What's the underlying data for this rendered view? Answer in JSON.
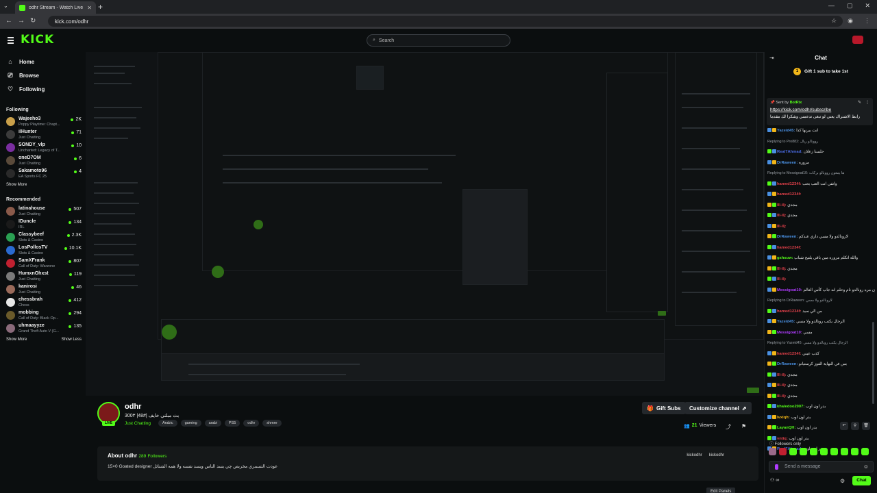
{
  "browser": {
    "tab_title": "odhr Stream - Watch Live on Ki",
    "url": "kick.com/odhr"
  },
  "topbar": {
    "logo": "KICK",
    "search_placeholder": "Search"
  },
  "sidebar": {
    "nav": [
      {
        "label": "Home",
        "icon": "home-icon"
      },
      {
        "label": "Browse",
        "icon": "browse-icon"
      },
      {
        "label": "Following",
        "icon": "heart-icon"
      }
    ],
    "following_title": "Following",
    "following": [
      {
        "name": "Wajeeho3",
        "sub": "Poppy Playtime: Chapt...",
        "count": "2K",
        "color": "#c9a04a"
      },
      {
        "name": "iIHunter",
        "sub": "Just Chatting",
        "count": "71",
        "color": "#3b3b3b"
      },
      {
        "name": "SONDY_vlp",
        "sub": "Uncharted: Legacy of T...",
        "count": "10",
        "color": "#7a2ea0"
      },
      {
        "name": "oneD7OM",
        "sub": "Just Chatting",
        "count": "6",
        "color": "#5a4a3a"
      },
      {
        "name": "Sakamoto96",
        "sub": "EA Sports FC 25",
        "count": "4",
        "color": "#2a2a2a"
      }
    ],
    "show_more_1": "Show More",
    "recommended_title": "Recommended",
    "recommended": [
      {
        "name": "latinahouse",
        "sub": "Just Chatting",
        "count": "507",
        "color": "#8a5a4a"
      },
      {
        "name": "IDuncle",
        "sub": "IRL",
        "count": "134",
        "color": "#1a1a1a"
      },
      {
        "name": "Classybeef",
        "sub": "Slots & Casino",
        "count": "2.3K",
        "color": "#2aa052"
      },
      {
        "name": "LosPollosTV",
        "sub": "Slots & Casino",
        "count": "10.1K",
        "color": "#2a6ad0"
      },
      {
        "name": "SamXFrank",
        "sub": "Call of Duty: Warzone",
        "count": "807",
        "color": "#c02030"
      },
      {
        "name": "HumxnOhxst",
        "sub": "Just Chatting",
        "count": "119",
        "color": "#7a7a7a"
      },
      {
        "name": "kanirosi",
        "sub": "Just Chatting",
        "count": "46",
        "color": "#9a6a5a"
      },
      {
        "name": "chessbrah",
        "sub": "Chess",
        "count": "412",
        "color": "#e8e8e8"
      },
      {
        "name": "mobbing",
        "sub": "Call of Duty: Black Op...",
        "count": "294",
        "color": "#6a5a2a"
      },
      {
        "name": "uhmaayyze",
        "sub": "Grand Theft Auto V (G...",
        "count": "135",
        "color": "#8a6a7a"
      }
    ],
    "show_more_2": "Show More",
    "show_less": "Show Less"
  },
  "channel": {
    "name": "odhr",
    "stream_title": "بث مبلني خايف |#48| 300٣",
    "category": "Just Chatting",
    "tags": [
      "Arabic",
      "gaming",
      "arabi",
      "PS5",
      "odhr",
      "shmre"
    ],
    "gift_subs": "Gift Subs",
    "customize": "Customize channel",
    "viewers_count": "21",
    "viewers_label": "Viewers",
    "live_badge": "LIVE",
    "about_title": "About odhr",
    "followers_count": "289",
    "followers_label": "Followers",
    "about_desc": "15×0 Goated designer عودت التسمري مخربص چي يسد الناس ويسد نفسه ولا همه الشتائل",
    "social_1": "kickodhr",
    "social_2": "kickodhr",
    "edit_label": "Edit Panels"
  },
  "chat": {
    "title": "Chat",
    "gift_banner": "Gift 1 sub to take 1st",
    "pinned_sent_by": "Sent by",
    "pinned_user": "BotRix",
    "pinned_link": "https://kick.com/odhr/subscribe",
    "pinned_text": "رابط الاشتراك يعني لو تبغى تدعمني وشكرا لك مقدما",
    "messages": [
      {
        "user": "Yazeid45:",
        "text": "انت بيرنها كذا",
        "color": "#4a90e2",
        "reply": ""
      },
      {
        "user": "",
        "text": "",
        "color": "#9aa0a6",
        "reply": "Replying to Pro882: روونالو ريال"
      },
      {
        "user": "Real7Ahmad:",
        "text": "حلسنا زعلان",
        "color": "#4a6ae2",
        "reply": ""
      },
      {
        "user": "DrRaween:",
        "text": "مزوره",
        "color": "#4a90e2",
        "reply": ""
      },
      {
        "user": "",
        "text": "",
        "color": "#9aa0a6",
        "reply": "Replying to Messigoat10: ها يمعون روونالو بركات"
      },
      {
        "user": "hamed1234f:",
        "text": "وانفي انت العب بحب",
        "color": "#e2404a",
        "reply": ""
      },
      {
        "user": "hamed1234f:",
        "text": "",
        "color": "#e2404a",
        "reply": ""
      },
      {
        "user": "lll-ilj:",
        "text": "مجدي",
        "color": "#e2404a",
        "reply": ""
      },
      {
        "user": "lll-ilj:",
        "text": "مجدي",
        "color": "#e2404a",
        "reply": ""
      },
      {
        "user": "lll-ilj:",
        "text": "",
        "color": "#e2404a",
        "reply": ""
      },
      {
        "user": "DrRaween:",
        "text": "لارونالدو ولا مسي داري عندكم",
        "color": "#4a90e2",
        "reply": ""
      },
      {
        "user": "hamed1234f:",
        "text": "",
        "color": "#e2404a",
        "reply": ""
      },
      {
        "user": "gshsuw:",
        "text": "والله اتكلم مزوره مين باقي يلتيح شباب",
        "color": "#53fc18",
        "reply": ""
      },
      {
        "user": "lll-ilj:",
        "text": "مجدي",
        "color": "#e2404a",
        "reply": ""
      },
      {
        "user": "lll-ilj:",
        "text": "",
        "color": "#e2404a",
        "reply": ""
      },
      {
        "user": "Messigoat10:",
        "text": "يقولون مره رونالدو نام وحلم انه جاب كأس العالم",
        "color": "#b03cff",
        "reply": ""
      },
      {
        "user": "",
        "text": "",
        "color": "#9aa0a6",
        "reply": "Replying to DrRaween: لارونالدو ولا مسي"
      },
      {
        "user": "hamed1234f:",
        "text": "من الي سيد",
        "color": "#e2404a",
        "reply": ""
      },
      {
        "user": "Yazeid45:",
        "text": "الرجال يكتب رونالدو ولا مسي",
        "color": "#4a90e2",
        "reply": ""
      },
      {
        "user": "Messigoat10:",
        "text": "مسي",
        "color": "#b03cff",
        "reply": ""
      },
      {
        "user": "",
        "text": "",
        "color": "#9aa0a6",
        "reply": "Replying to Yazeid45: الرجال يكتب رونالدو ولا مسي"
      },
      {
        "user": "hamed1234f:",
        "text": "كذب عيني",
        "color": "#e2404a",
        "reply": ""
      },
      {
        "user": "DrRaween:",
        "text": "بس في النهاية الفوز كرستيانو",
        "color": "#4a90e2",
        "reply": ""
      },
      {
        "user": "lll-ilj:",
        "text": "مجدي",
        "color": "#e2404a",
        "reply": ""
      },
      {
        "user": "lll-ilj:",
        "text": "مجدي",
        "color": "#e2404a",
        "reply": ""
      },
      {
        "user": "lll-ilj:",
        "text": "مجدي",
        "color": "#e2404a",
        "reply": ""
      },
      {
        "user": "khaledoo2007:",
        "text": "بدر اون اوب",
        "color": "#53fc18",
        "reply": ""
      },
      {
        "user": "lvxiqh:",
        "text": "بدر اون اوب",
        "color": "#f2b619",
        "reply": ""
      },
      {
        "user": "LayanQH:",
        "text": "بدر اون اوب",
        "color": "#53fc18",
        "reply": ""
      },
      {
        "user": "vntiq:",
        "text": "بدر اون اوب",
        "color": "#e2404a",
        "reply": ""
      },
      {
        "user": "Real7Ahmad:",
        "text": "بدر اون اوب",
        "color": "#4a6ae2",
        "reply": ""
      }
    ],
    "followers_only": "Followers only",
    "input_placeholder": "Send a message",
    "send_label": "Chat"
  }
}
